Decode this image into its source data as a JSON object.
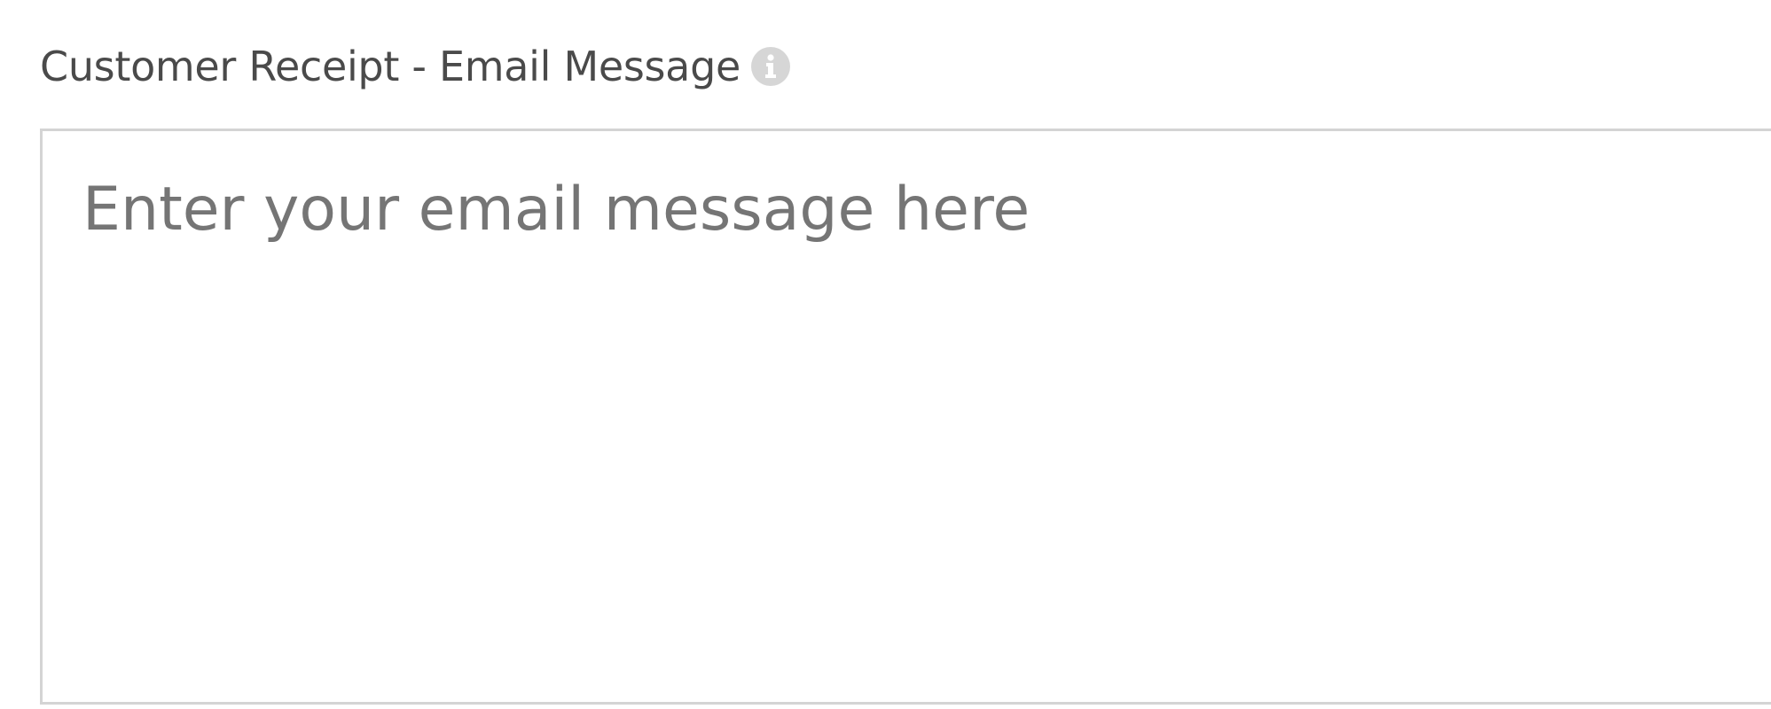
{
  "field": {
    "label": "Customer Receipt - Email Message",
    "info_icon": "info-icon",
    "message_value": "",
    "message_placeholder": "Enter your email message here"
  },
  "colors": {
    "label_text": "#4a4a4a",
    "placeholder_text": "#757575",
    "border": "#d4d4d4",
    "info_icon_bg": "#d6d6d6"
  }
}
